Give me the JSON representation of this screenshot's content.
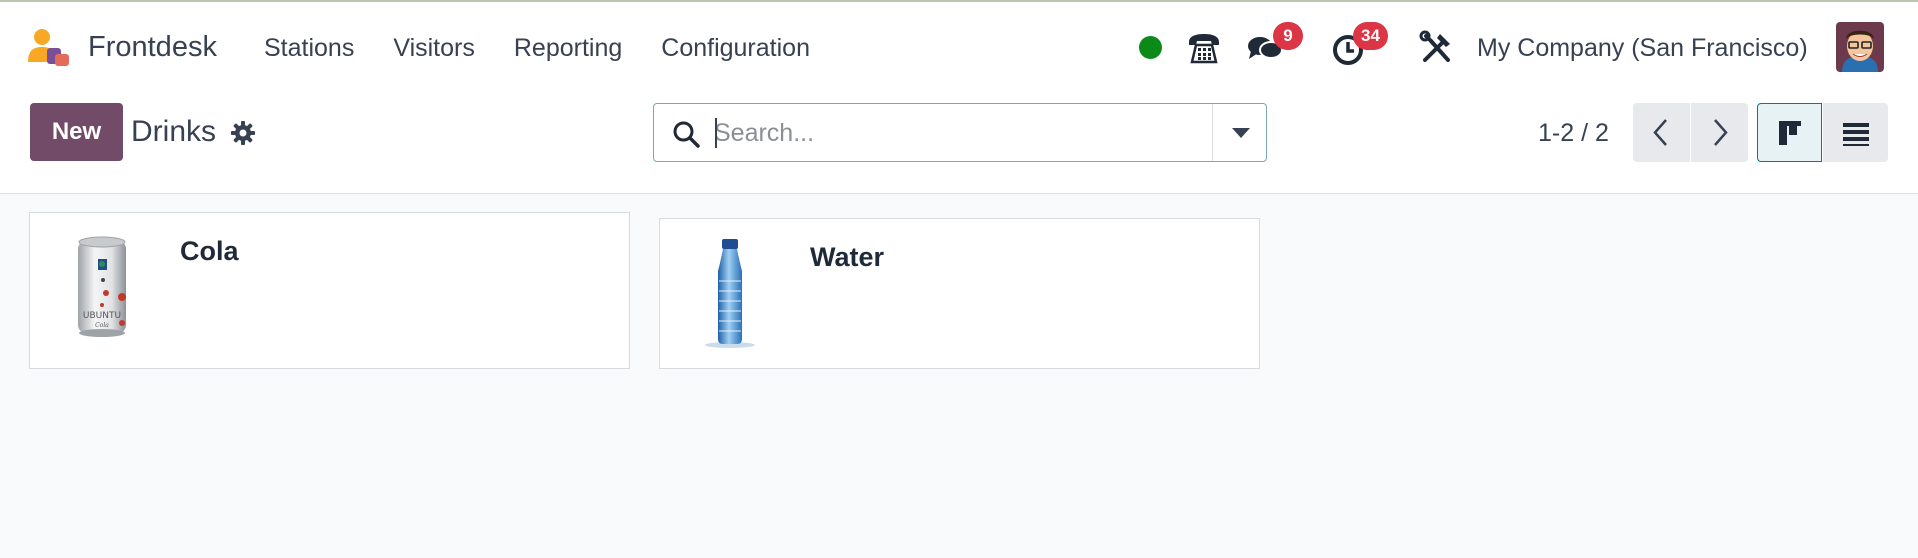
{
  "app": {
    "name": "Frontdesk"
  },
  "menu": {
    "items": [
      "Stations",
      "Visitors",
      "Reporting",
      "Configuration"
    ]
  },
  "systray": {
    "status_color": "#0b8a1a",
    "icons": [
      "phone-icon",
      "chat-icon",
      "activity-clock-icon",
      "debug-tools-icon"
    ],
    "messages_count": "9",
    "activities_count": "34",
    "company": "My Company (San Francisco)"
  },
  "control_panel": {
    "new_label": "New",
    "title": "Drinks",
    "search_placeholder": "Search...",
    "pager": "1-2 / 2",
    "active_view": "kanban"
  },
  "records": [
    {
      "name": "Cola",
      "image": "ubuntu-cola-can",
      "image_text": "UBUNTU"
    },
    {
      "name": "Water",
      "image": "water-bottle"
    }
  ],
  "colors": {
    "primary": "#714b67",
    "accent": "#017e84",
    "badge": "#dc3545"
  }
}
